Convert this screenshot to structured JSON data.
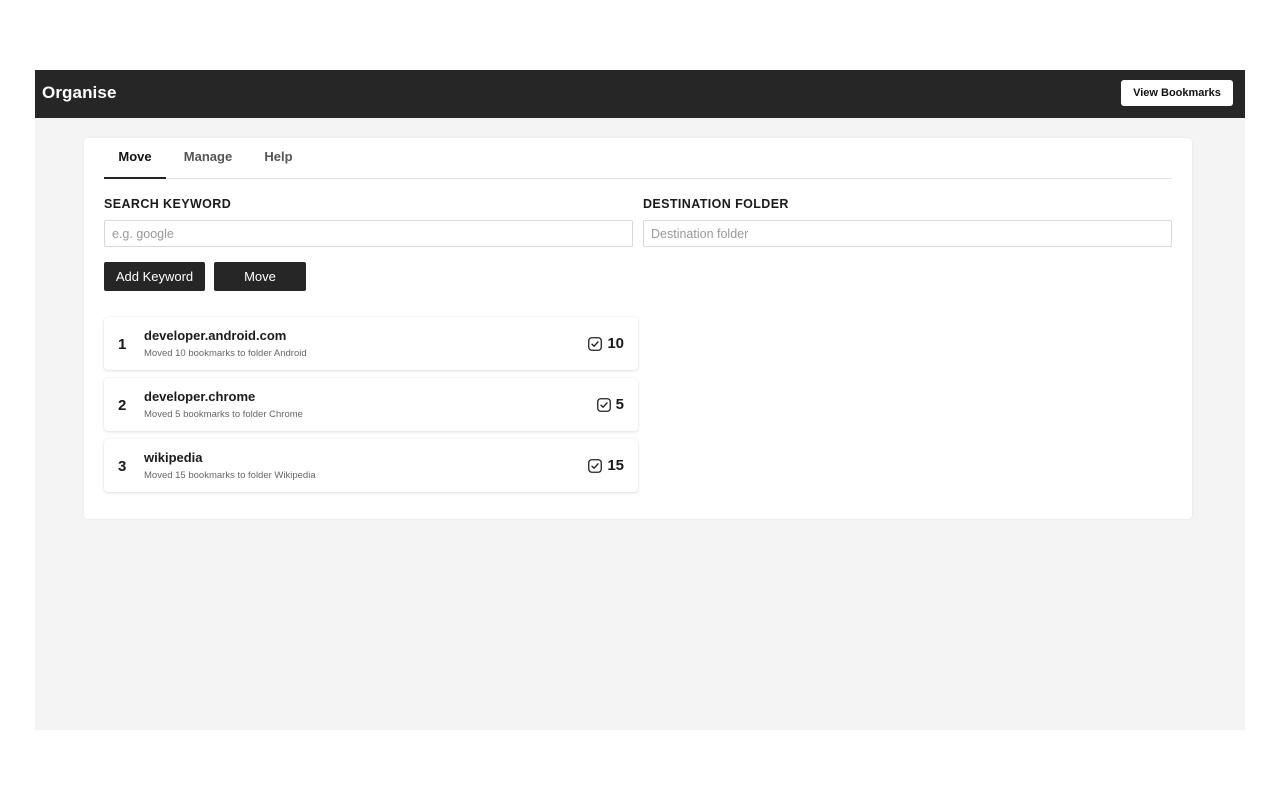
{
  "header": {
    "title": "Organise",
    "view_bookmarks_label": "View Bookmarks"
  },
  "tabs": [
    {
      "label": "Move",
      "active": true
    },
    {
      "label": "Manage",
      "active": false
    },
    {
      "label": "Help",
      "active": false
    }
  ],
  "form": {
    "search_label": "SEARCH KEYWORD",
    "search_placeholder": "e.g. google",
    "search_value": "",
    "destination_label": "DESTINATION FOLDER",
    "destination_placeholder": "Destination folder",
    "destination_value": "",
    "add_keyword_label": "Add Keyword",
    "move_label": "Move"
  },
  "results": [
    {
      "index": "1",
      "keyword": "developer.android.com",
      "description": "Moved 10 bookmarks to folder Android",
      "count": "10",
      "icon": "checkbox-checked-icon"
    },
    {
      "index": "2",
      "keyword": "developer.chrome",
      "description": "Moved 5 bookmarks to folder Chrome",
      "count": "5",
      "icon": "checkbox-checked-icon"
    },
    {
      "index": "3",
      "keyword": "wikipedia",
      "description": "Moved 15 bookmarks to folder Wikipedia",
      "count": "15",
      "icon": "checkbox-checked-icon"
    }
  ],
  "colors": {
    "header_bg": "#262626",
    "page_bg": "#f4f4f4",
    "button_dark": "#262626"
  }
}
